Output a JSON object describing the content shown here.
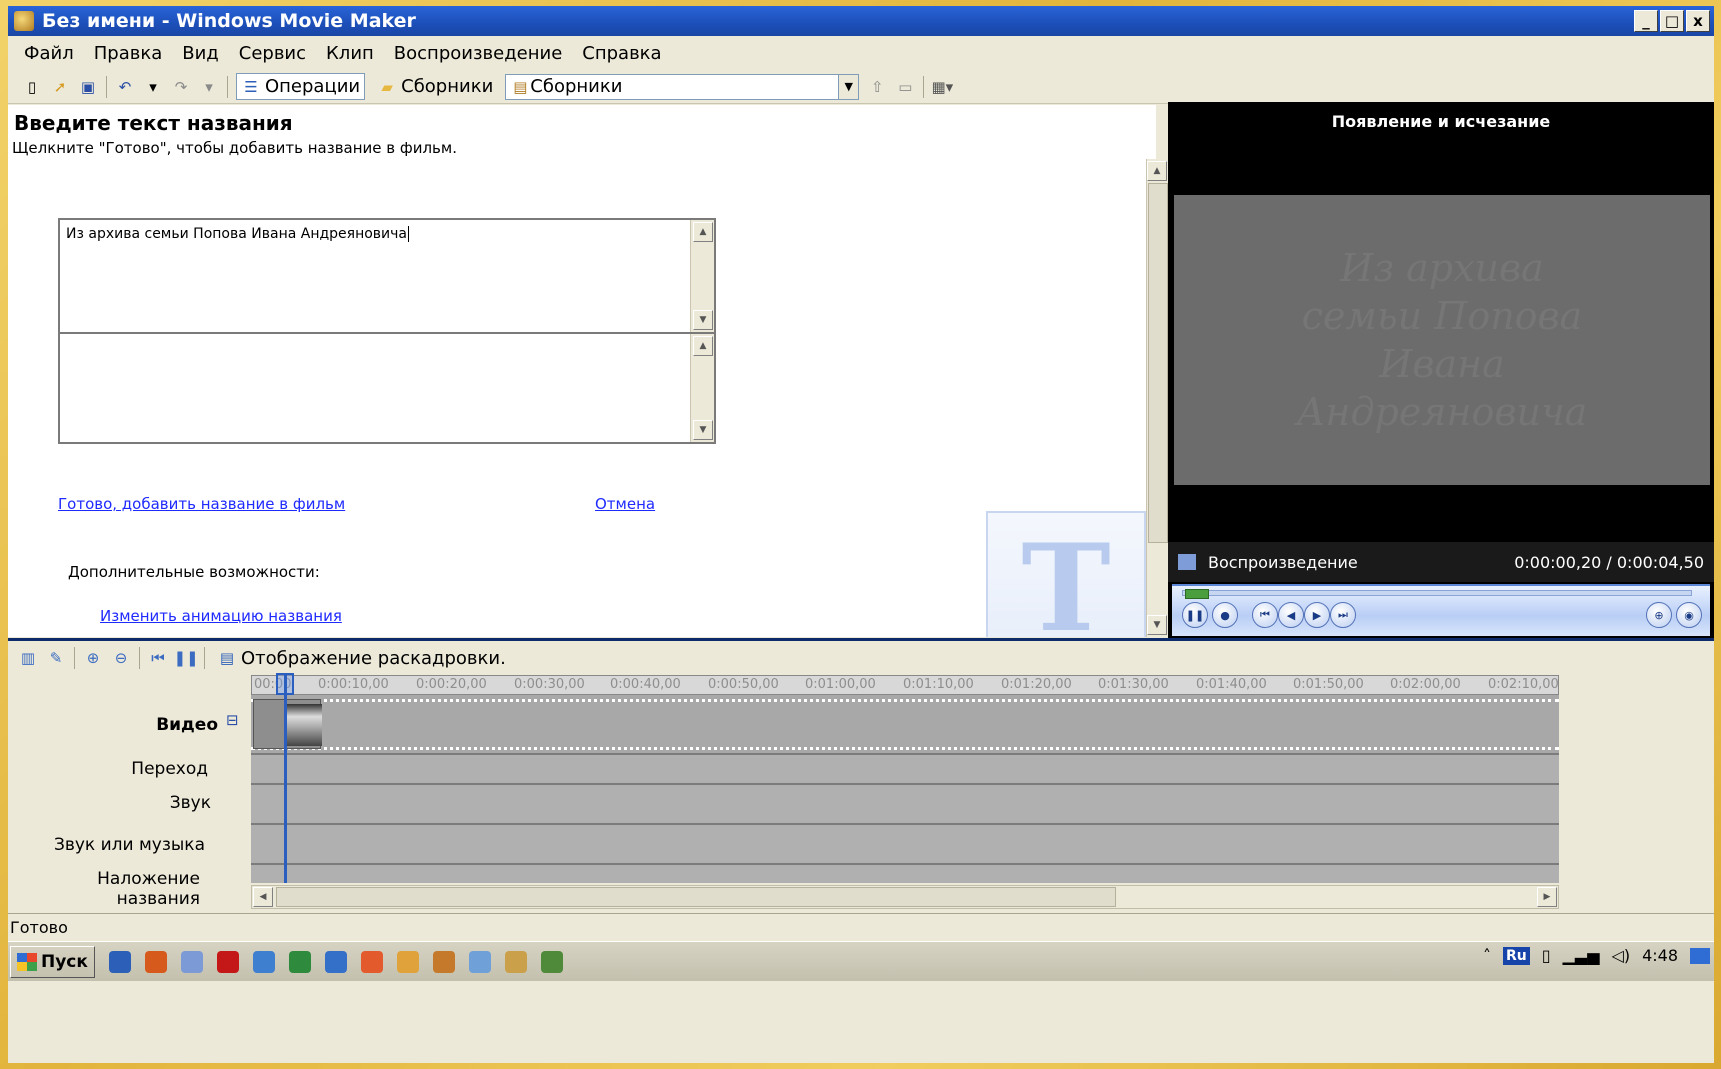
{
  "window": {
    "title": "Без имени - Windows Movie Maker",
    "controls": [
      "_",
      "□",
      "x"
    ]
  },
  "menu": [
    "Файл",
    "Правка",
    "Вид",
    "Сервис",
    "Клип",
    "Воспроизведение",
    "Справка"
  ],
  "toolbar": {
    "operations_label": "Операции",
    "collections_label": "Сборники",
    "collections_combo_value": "Сборники"
  },
  "task": {
    "heading": "Введите текст названия",
    "subtitle": "Щелкните \"Готово\", чтобы добавить название в фильм.",
    "title_text": "Из архива семьи Попова Ивана Андреяновича",
    "subtitle_text": "",
    "done_link": "Готово, добавить название в фильм",
    "cancel_link": "Отмена",
    "extra_label": "Дополнительные возможности:",
    "change_anim_link": "Изменить анимацию названия",
    "watermark_letter": "T"
  },
  "monitor": {
    "title": "Появление и исчезание",
    "preview_text": "Из архива семьи Попова Ивана Андреяновича",
    "status_label": "Воспроизведение",
    "time": "0:00:00,20 / 0:00:04,50"
  },
  "timeline": {
    "mode_label": "Отображение раскадровки.",
    "ticks": [
      "00:00",
      "0:00:10,00",
      "0:00:20,00",
      "0:00:30,00",
      "0:00:40,00",
      "0:00:50,00",
      "0:01:00,00",
      "0:01:10,00",
      "0:01:20,00",
      "0:01:30,00",
      "0:01:40,00",
      "0:01:50,00",
      "0:02:00,00",
      "0:02:10,00"
    ],
    "tracks": {
      "video": "Видео",
      "transition": "Переход",
      "audio": "Звук",
      "music": "Звук или музыка",
      "title_overlay": "Наложение названия"
    },
    "collapse_glyph": "⊟"
  },
  "status": "Готово",
  "taskbar": {
    "start_label": "Пуск",
    "lang": "Ru",
    "clock": "4:48",
    "app_colors": [
      "#2b5fb8",
      "#d65a1c",
      "#7b9ad6",
      "#c41818",
      "#3f7fd0",
      "#2e8b3d",
      "#3470c8",
      "#e35b2d",
      "#e0a23a",
      "#c47a2a",
      "#6fa0d8",
      "#caa14a",
      "#4f8a3a"
    ]
  },
  "colors": {
    "titlebar": "#1c4fb8",
    "link": "#1f2aff",
    "monitor_bg": "#000000",
    "playhead": "#2a5fc0"
  }
}
